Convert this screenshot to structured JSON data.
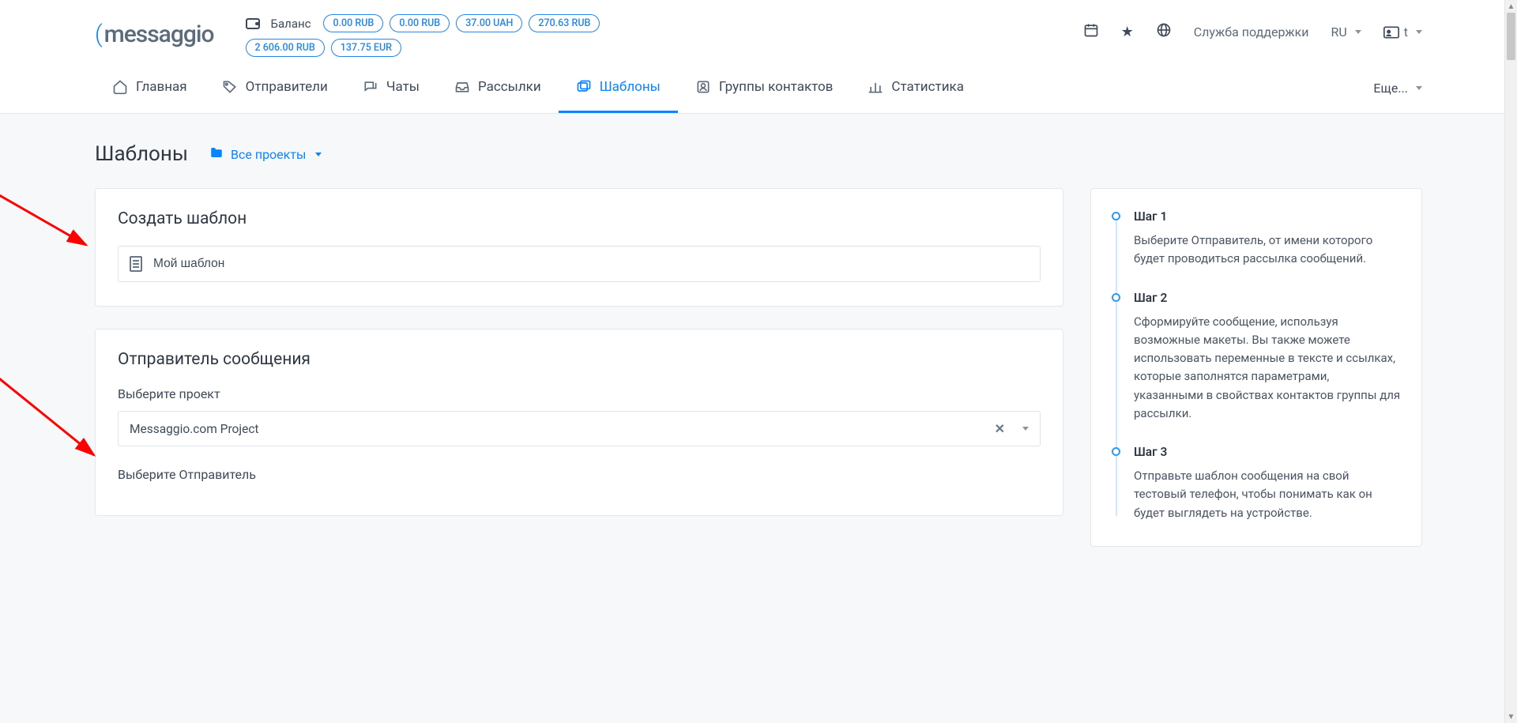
{
  "header": {
    "logo_text": "messaggio",
    "balance_label": "Баланс",
    "balances": [
      "0.00 RUB",
      "0.00 RUB",
      "37.00 UAH",
      "270.63 RUB",
      "2 606.00 RUB",
      "137.75 EUR"
    ],
    "support_label": "Служба поддержки",
    "lang": "RU",
    "user": "t"
  },
  "nav": {
    "items": [
      {
        "label": "Главная"
      },
      {
        "label": "Отправители"
      },
      {
        "label": "Чаты"
      },
      {
        "label": "Рассылки"
      },
      {
        "label": "Шаблоны",
        "active": true
      },
      {
        "label": "Группы контактов"
      },
      {
        "label": "Статистика"
      }
    ],
    "more": "Еще..."
  },
  "page": {
    "title": "Шаблоны",
    "project_filter": "Все проекты"
  },
  "card_create": {
    "title": "Создать шаблон",
    "input_value": "Мой шаблон"
  },
  "card_sender": {
    "title": "Отправитель сообщения",
    "project_label": "Выберите проект",
    "project_value": "Messaggio.com Project",
    "sender_label": "Выберите Отправитель"
  },
  "steps": [
    {
      "title": "Шаг 1",
      "text": "Выберите Отправитель, от имени которого будет проводиться рассылка сообщений."
    },
    {
      "title": "Шаг 2",
      "text": "Сформируйте сообщение, используя возможные макеты. Вы также можете использовать переменные в тексте и ссылках, которые заполнятся параметрами, указанными в свойствах контактов группы для рассылки."
    },
    {
      "title": "Шаг 3",
      "text": "Отправьте шаблон сообщения на свой тестовый телефон, чтобы понимать как он будет выглядеть на устройстве."
    }
  ]
}
